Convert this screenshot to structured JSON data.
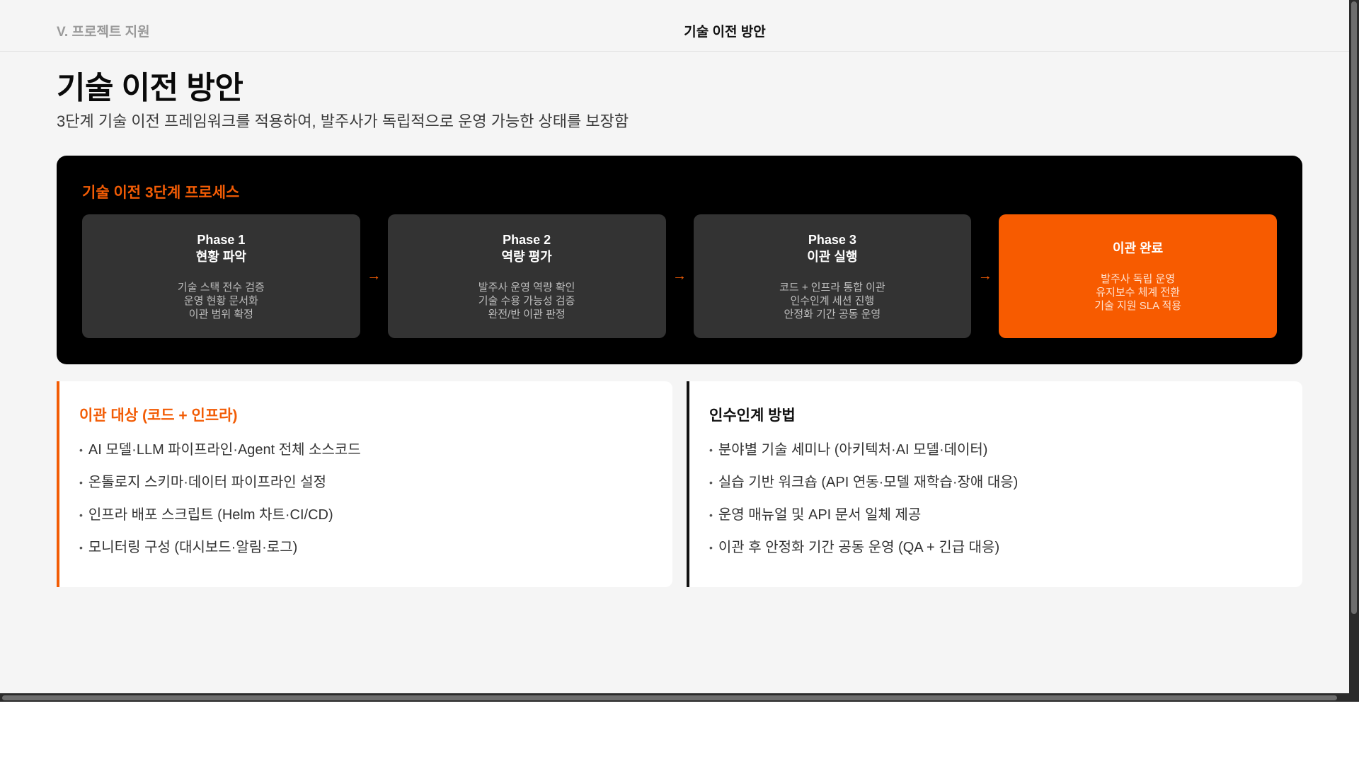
{
  "header": {
    "section_label": "V. 프로젝트 지원",
    "title": "기술 이전 방안"
  },
  "page": {
    "title": "기술 이전 방안",
    "subtitle": "3단계 기술 이전 프레임워크를 적용하여, 발주사가 독립적으로 운영 가능한 상태를 보장함"
  },
  "process": {
    "title": "기술 이전 3단계 프로세스",
    "phases": [
      {
        "head1": "Phase 1",
        "head2": "현황 파악",
        "desc": [
          "기술 스택 전수 검증",
          "운영 현황 문서화",
          "이관 범위 확정"
        ]
      },
      {
        "head1": "Phase 2",
        "head2": "역량 평가",
        "desc": [
          "발주사 운영 역량 확인",
          "기술 수용 가능성 검증",
          "완전/반 이관 판정"
        ]
      },
      {
        "head1": "Phase 3",
        "head2": "이관 실행",
        "desc": [
          "코드 + 인프라 통합 이관",
          "인수인계 세션 진행",
          "안정화 기간 공동 운영"
        ]
      },
      {
        "head1": "이관 완료",
        "desc": [
          "발주사 독립 운영",
          "유지보수 체계 전환",
          "기술 지원 SLA 적용"
        ]
      }
    ],
    "arrow": "→",
    "accent_color": "#f25c05"
  },
  "targets": {
    "title": "이관 대상 (코드 + 인프라)",
    "items": [
      "AI 모델·LLM 파이프라인·Agent 전체 소스코드",
      "온톨로지 스키마·데이터 파이프라인 설정",
      "인프라 배포 스크립트 (Helm 차트·CI/CD)",
      "모니터링 구성 (대시보드·알림·로그)"
    ]
  },
  "handover": {
    "title": "인수인계 방법",
    "items": [
      "분야별 기술 세미나 (아키텍처·AI 모델·데이터)",
      "실습 기반 워크숍 (API 연동·모델 재학습·장애 대응)",
      "운영 매뉴얼 및 API 문서 일체 제공",
      "이관 후 안정화 기간 공동 운영 (QA + 긴급 대응)"
    ]
  },
  "bullet": "•"
}
